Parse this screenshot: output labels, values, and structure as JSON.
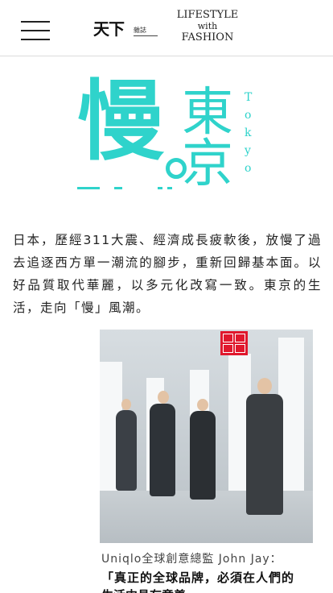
{
  "header": {
    "logo_cn": "天下",
    "logo_sub": "雜誌",
    "logo_en_line1": "LIFESTYLE",
    "logo_en_line2": "with",
    "logo_en_line3": "FASHION"
  },
  "hero": {
    "title_main": "慢",
    "title_city": "東京",
    "title_en": "Tokyo",
    "accent_color": "#2fd3cb"
  },
  "intro": {
    "text": "日本，歷經311大震、經濟成長疲軟後，放慢了過去追逐西方單一潮流的腳步，重新回歸基本面。以好品質取代華麗，以多元化改寫一致。東京的生活，走向「慢」風潮。"
  },
  "figure": {
    "store_logo": "UNIQLO",
    "caption": "Uniqlo全球創意總監 John Jay：",
    "quote": "「真正的全球品牌，必須在人們的",
    "quote_next": "生活中具有意義"
  }
}
